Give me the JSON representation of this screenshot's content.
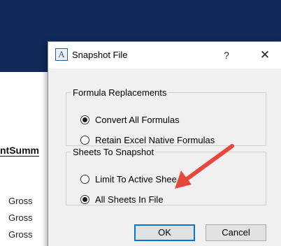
{
  "background": {
    "heading": "ntSumm",
    "rows": [
      "Gross",
      "Gross",
      "Gross"
    ]
  },
  "dialog": {
    "app_icon_glyph": "A",
    "title": "Snapshot File",
    "help_glyph": "?",
    "close_glyph": "✕",
    "groups": [
      {
        "legend": "Formula Replacements",
        "options": [
          {
            "label": "Convert All Formulas",
            "checked": true
          },
          {
            "label": "Retain Excel Native Formulas",
            "checked": false
          }
        ]
      },
      {
        "legend": "Sheets To Snapshot",
        "options": [
          {
            "label": "Limit To Active Shee",
            "checked": false
          },
          {
            "label": "All Sheets In File",
            "checked": true
          }
        ]
      }
    ],
    "ok_label": "OK",
    "cancel_label": "Cancel"
  },
  "colors": {
    "banner": "#10295a",
    "annotation_arrow": "#e8473c",
    "default_button_border": "#0078d7"
  }
}
